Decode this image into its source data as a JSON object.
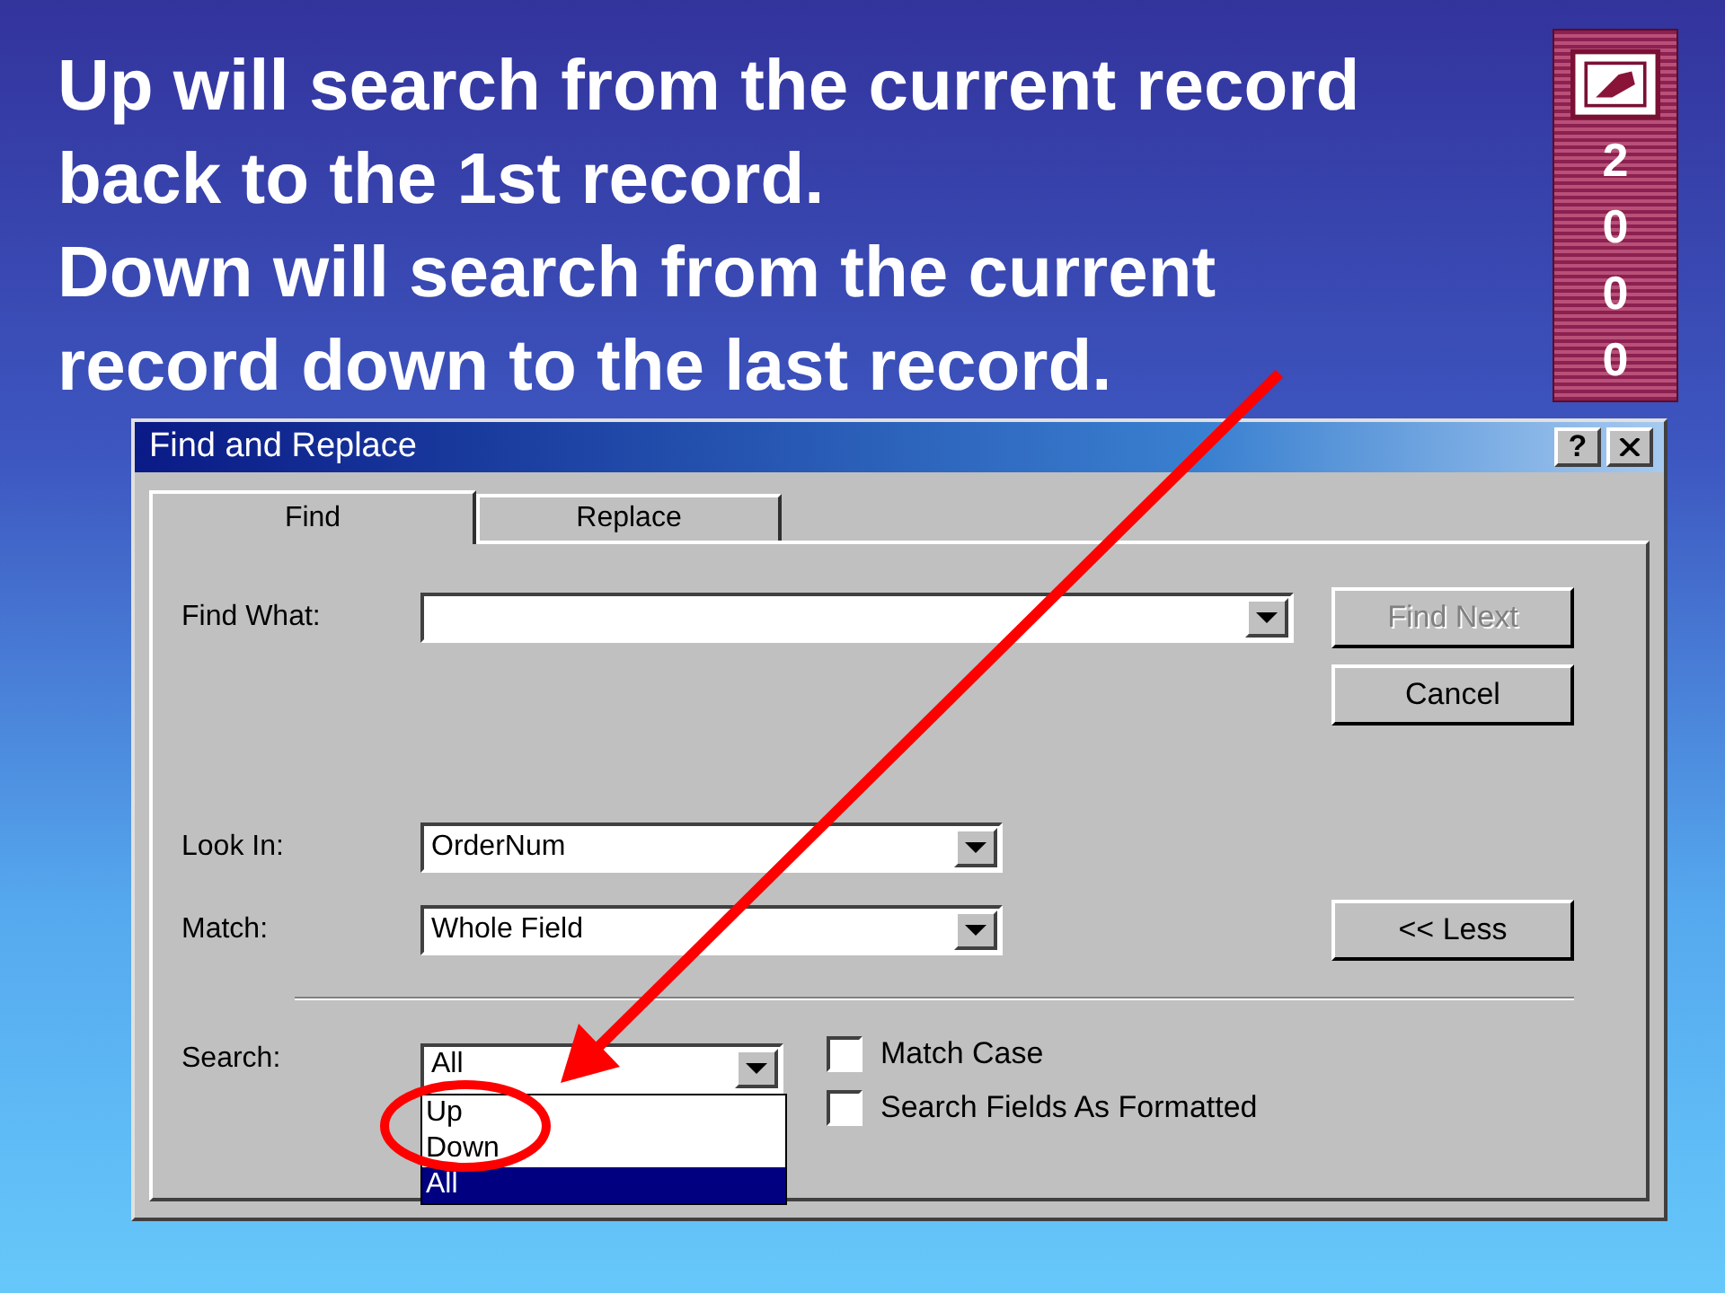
{
  "slide": {
    "paragraphs": [
      "Up will search from the current record back to the 1st record.",
      "Down will search from the current record down to the last record."
    ],
    "badge": "2000"
  },
  "dialog": {
    "title": "Find and Replace",
    "help": "?",
    "tabs": [
      {
        "label": "Find",
        "selected": true
      },
      {
        "label": "Replace",
        "selected": false
      }
    ],
    "find_what": {
      "label": "Find What:"
    },
    "look_in": {
      "label": "Look In:",
      "value": "OrderNum"
    },
    "match": {
      "label": "Match:",
      "value": "Whole Field"
    },
    "search": {
      "label": "Search:",
      "value": "All",
      "options": [
        {
          "label": "Up",
          "selected": false
        },
        {
          "label": "Down",
          "selected": false
        },
        {
          "label": "All",
          "selected": true
        }
      ]
    },
    "buttons": [
      {
        "label": "Find Next",
        "disabled": true
      },
      {
        "label": "Cancel",
        "disabled": false
      },
      {
        "label": "<< Less",
        "disabled": false
      }
    ],
    "checkboxes": [
      {
        "label": "Match Case",
        "checked": false
      },
      {
        "label": "Search Fields As Formatted",
        "checked": false
      }
    ]
  }
}
